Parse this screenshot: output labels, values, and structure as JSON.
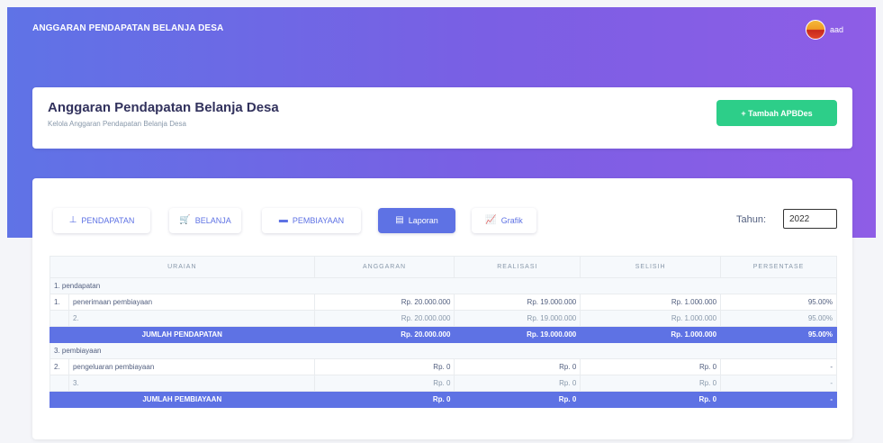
{
  "app": {
    "title": "ANGGARAN PENDAPATAN BELANJA DESA"
  },
  "user": {
    "name": "aad"
  },
  "header": {
    "title": "Anggaran Pendapatan Belanja Desa",
    "subtitle": "Kelola Anggaran Pendapatan Belanja Desa",
    "add_button": "+ Tambah APBDes"
  },
  "tabs": [
    {
      "label": "PENDAPATAN",
      "icon": "hand-holding-icon",
      "glyph": "⊥"
    },
    {
      "label": "BELANJA",
      "icon": "cart-icon",
      "glyph": "🛒"
    },
    {
      "label": "PEMBIAYAAN",
      "icon": "money-icon",
      "glyph": "▬"
    },
    {
      "label": "Laporan",
      "icon": "report-icon",
      "glyph": "▤"
    },
    {
      "label": "Grafik",
      "icon": "chart-icon",
      "glyph": "📈"
    }
  ],
  "year": {
    "label": "Tahun:",
    "value": "2022"
  },
  "table": {
    "headers": [
      "URAIAN",
      "ANGGARAN",
      "REALISASI",
      "SELISIH",
      "PERSENTASE"
    ],
    "rows": [
      {
        "type": "group",
        "label": "1. pendapatan"
      },
      {
        "type": "item",
        "no": "1.",
        "label": "penerimaan pembiayaan",
        "anggaran": "Rp. 20.000.000",
        "realisasi": "Rp. 19.000.000",
        "selisih": "Rp. 1.000.000",
        "persen": "95.00%"
      },
      {
        "type": "sub",
        "no": "",
        "label": "2.",
        "anggaran": "Rp. 20.000.000",
        "realisasi": "Rp. 19.000.000",
        "selisih": "Rp. 1.000.000",
        "persen": "95.00%"
      },
      {
        "type": "total",
        "label": "JUMLAH PENDAPATAN",
        "anggaran": "Rp. 20.000.000",
        "realisasi": "Rp. 19.000.000",
        "selisih": "Rp. 1.000.000",
        "persen": "95.00%"
      },
      {
        "type": "group",
        "label": "3. pembiayaan"
      },
      {
        "type": "item",
        "no": "2.",
        "label": "pengeluaran pembiayaan",
        "anggaran": "Rp. 0",
        "realisasi": "Rp. 0",
        "selisih": "Rp. 0",
        "persen": "-"
      },
      {
        "type": "sub",
        "no": "",
        "label": "3.",
        "anggaran": "Rp. 0",
        "realisasi": "Rp. 0",
        "selisih": "Rp. 0",
        "persen": "-"
      },
      {
        "type": "total",
        "label": "JUMLAH PEMBIAYAAN",
        "anggaran": "Rp. 0",
        "realisasi": "Rp. 0",
        "selisih": "Rp. 0",
        "persen": "-"
      }
    ]
  },
  "colors": {
    "primary": "#5e72e4",
    "success": "#2dce89",
    "gradient_end": "#8e5de6"
  }
}
